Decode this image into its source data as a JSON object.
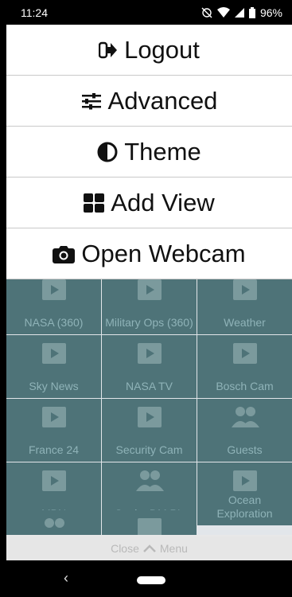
{
  "status": {
    "time": "11:24",
    "battery": "96%"
  },
  "menu": {
    "items": [
      {
        "label": "Logout",
        "icon": "logout-icon"
      },
      {
        "label": "Advanced",
        "icon": "sliders-icon"
      },
      {
        "label": "Theme",
        "icon": "contrast-icon"
      },
      {
        "label": "Add View",
        "icon": "grid-icon"
      },
      {
        "label": "Open Webcam",
        "icon": "camera-icon"
      }
    ]
  },
  "tiles": [
    {
      "label": "NASA (360)",
      "icon": "video-icon"
    },
    {
      "label": "Military Ops (360)",
      "icon": "video-icon"
    },
    {
      "label": "Weather",
      "icon": "video-icon"
    },
    {
      "label": "Sky News",
      "icon": "video-icon"
    },
    {
      "label": "NASA TV",
      "icon": "video-icon"
    },
    {
      "label": "Bosch Cam",
      "icon": "video-icon"
    },
    {
      "label": "France 24",
      "icon": "video-icon"
    },
    {
      "label": "Security Cam",
      "icon": "video-icon"
    },
    {
      "label": "Guests",
      "icon": "group-icon"
    },
    {
      "label": "MBN",
      "icon": "video-icon"
    },
    {
      "label": "Sonim DM PL",
      "icon": "group-icon"
    },
    {
      "label": "Ocean Exploration",
      "icon": "video-icon"
    },
    {
      "label": "",
      "icon": "group-icon"
    },
    {
      "label": "",
      "icon": "video-icon"
    }
  ],
  "close_bar": {
    "label_before": "Close",
    "label_after": "Menu"
  },
  "colors": {
    "tile": "#4e7378",
    "overlay": "#e2e6ea",
    "menu_bg": "#ffffff"
  }
}
